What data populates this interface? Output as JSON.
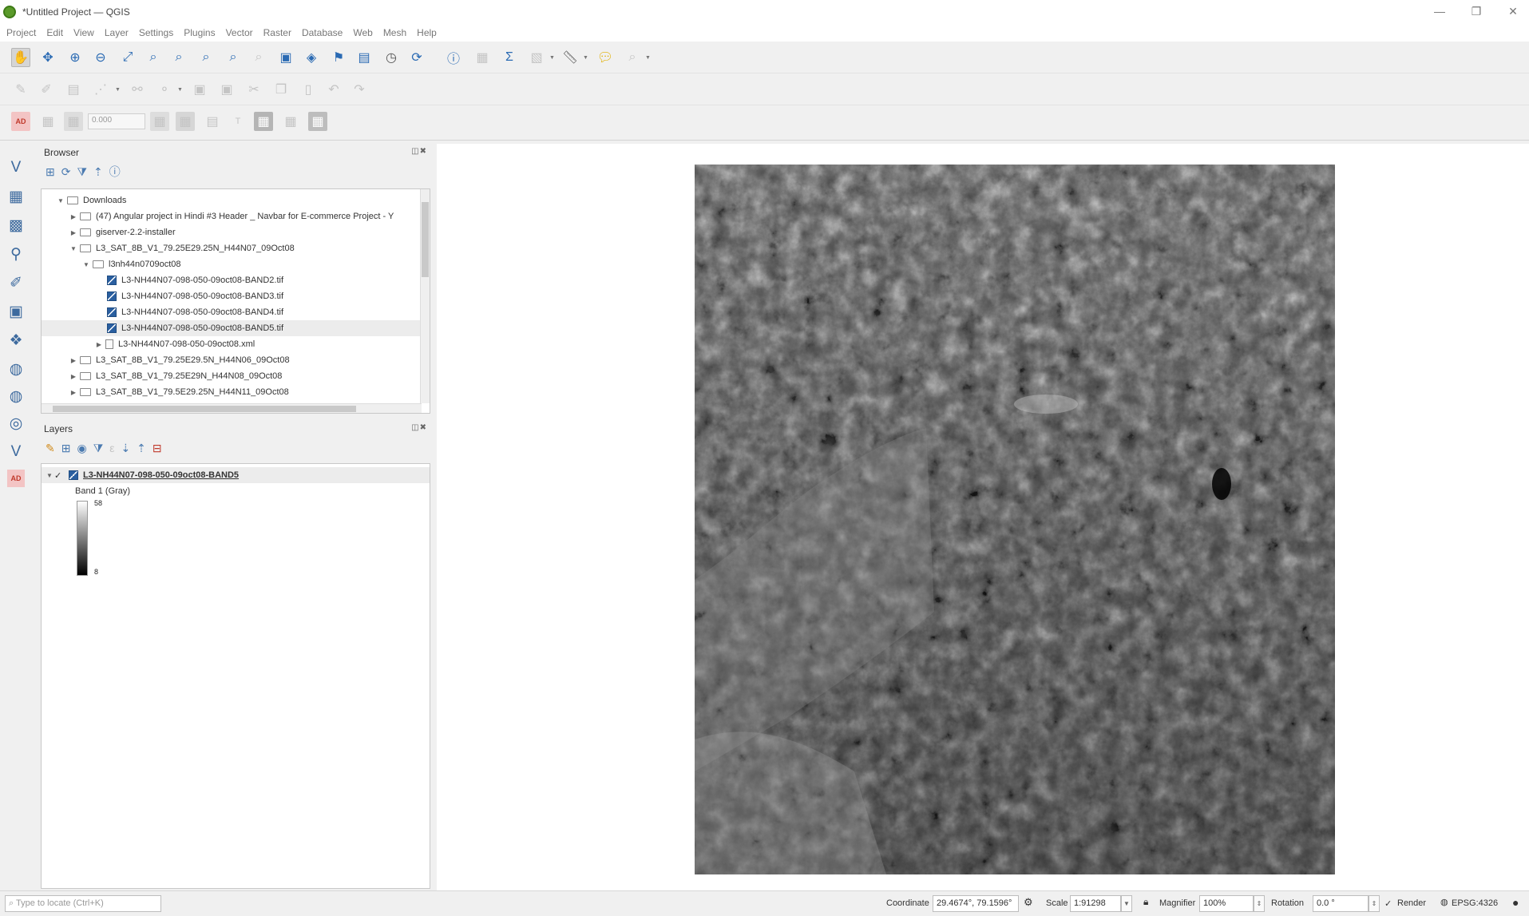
{
  "window": {
    "title": "*Untitled Project — QGIS",
    "minimize_glyph": "—",
    "maximize_glyph": "❐",
    "close_glyph": "✕"
  },
  "menubar": {
    "items": [
      "Project",
      "Edit",
      "View",
      "Layer",
      "Settings",
      "Plugins",
      "Vector",
      "Raster",
      "Database",
      "Web",
      "Mesh",
      "Help"
    ]
  },
  "digitizing": {
    "snap_tolerance": "0.000",
    "t_label": "T"
  },
  "browser_panel": {
    "title": "Browser",
    "controls": "◫✖",
    "tree": [
      {
        "label": "Downloads",
        "kind": "folder",
        "arrow": "▼"
      },
      {
        "label": "(47) Angular project in Hindi #3 Header _ Navbar for E-commerce Project - Y",
        "kind": "folder",
        "arrow": "▶"
      },
      {
        "label": "giserver-2.2-installer",
        "kind": "folder",
        "arrow": "▶"
      },
      {
        "label": "L3_SAT_8B_V1_79.25E29.25N_H44N07_09Oct08",
        "kind": "folder",
        "arrow": "▼"
      },
      {
        "label": "l3nh44n0709oct08",
        "kind": "folder",
        "arrow": "▼"
      },
      {
        "label": "L3-NH44N07-098-050-09oct08-BAND2.tif",
        "kind": "raster",
        "arrow": ""
      },
      {
        "label": "L3-NH44N07-098-050-09oct08-BAND3.tif",
        "kind": "raster",
        "arrow": ""
      },
      {
        "label": "L3-NH44N07-098-050-09oct08-BAND4.tif",
        "kind": "raster",
        "arrow": ""
      },
      {
        "label": "L3-NH44N07-098-050-09oct08-BAND5.tif",
        "kind": "raster",
        "arrow": "",
        "highlighted": true
      },
      {
        "label": "L3-NH44N07-098-050-09oct08.xml",
        "kind": "file",
        "arrow": "▶"
      },
      {
        "label": "L3_SAT_8B_V1_79.25E29.5N_H44N06_09Oct08",
        "kind": "folder",
        "arrow": "▶"
      },
      {
        "label": "L3_SAT_8B_V1_79.25E29N_H44N08_09Oct08",
        "kind": "folder",
        "arrow": "▶"
      },
      {
        "label": "L3_SAT_8B_V1_79.5E29.25N_H44N11_09Oct08",
        "kind": "folder",
        "arrow": "▶"
      }
    ]
  },
  "layers_panel": {
    "title": "Layers",
    "controls": "◫✖",
    "layer": {
      "name": "L3-NH44N07-098-050-09oct08-BAND5",
      "checked": "✓",
      "band_label": "Band 1 (Gray)",
      "max_value": "58",
      "min_value": "8"
    }
  },
  "statusbar": {
    "locator_placeholder": "Type to locate (Ctrl+K)",
    "coordinate_label": "Coordinate",
    "coordinate_value": "29.4674°, 79.1596°",
    "scale_label": "Scale",
    "scale_value": "1:91298",
    "magnifier_label": "Magnifier",
    "magnifier_value": "100%",
    "rotation_label": "Rotation",
    "rotation_value": "0.0 °",
    "render_label": "Render",
    "render_checked": "✓",
    "crs_value": "EPSG:4326"
  },
  "colors": {
    "accent": "#2a6ab3",
    "qgis_green": "#5a9a2a",
    "highlight_row": "#ececec"
  },
  "icons": {
    "pan": "✋",
    "pan_to_selection": "✥",
    "zoom_in": "🔍︎",
    "zoom_out": "🔎︎",
    "refresh": "⟳",
    "identify": "ⓘ",
    "sum": "Σ",
    "measure": "📏︎",
    "tip": "💬︎",
    "clock": "🕒︎"
  }
}
